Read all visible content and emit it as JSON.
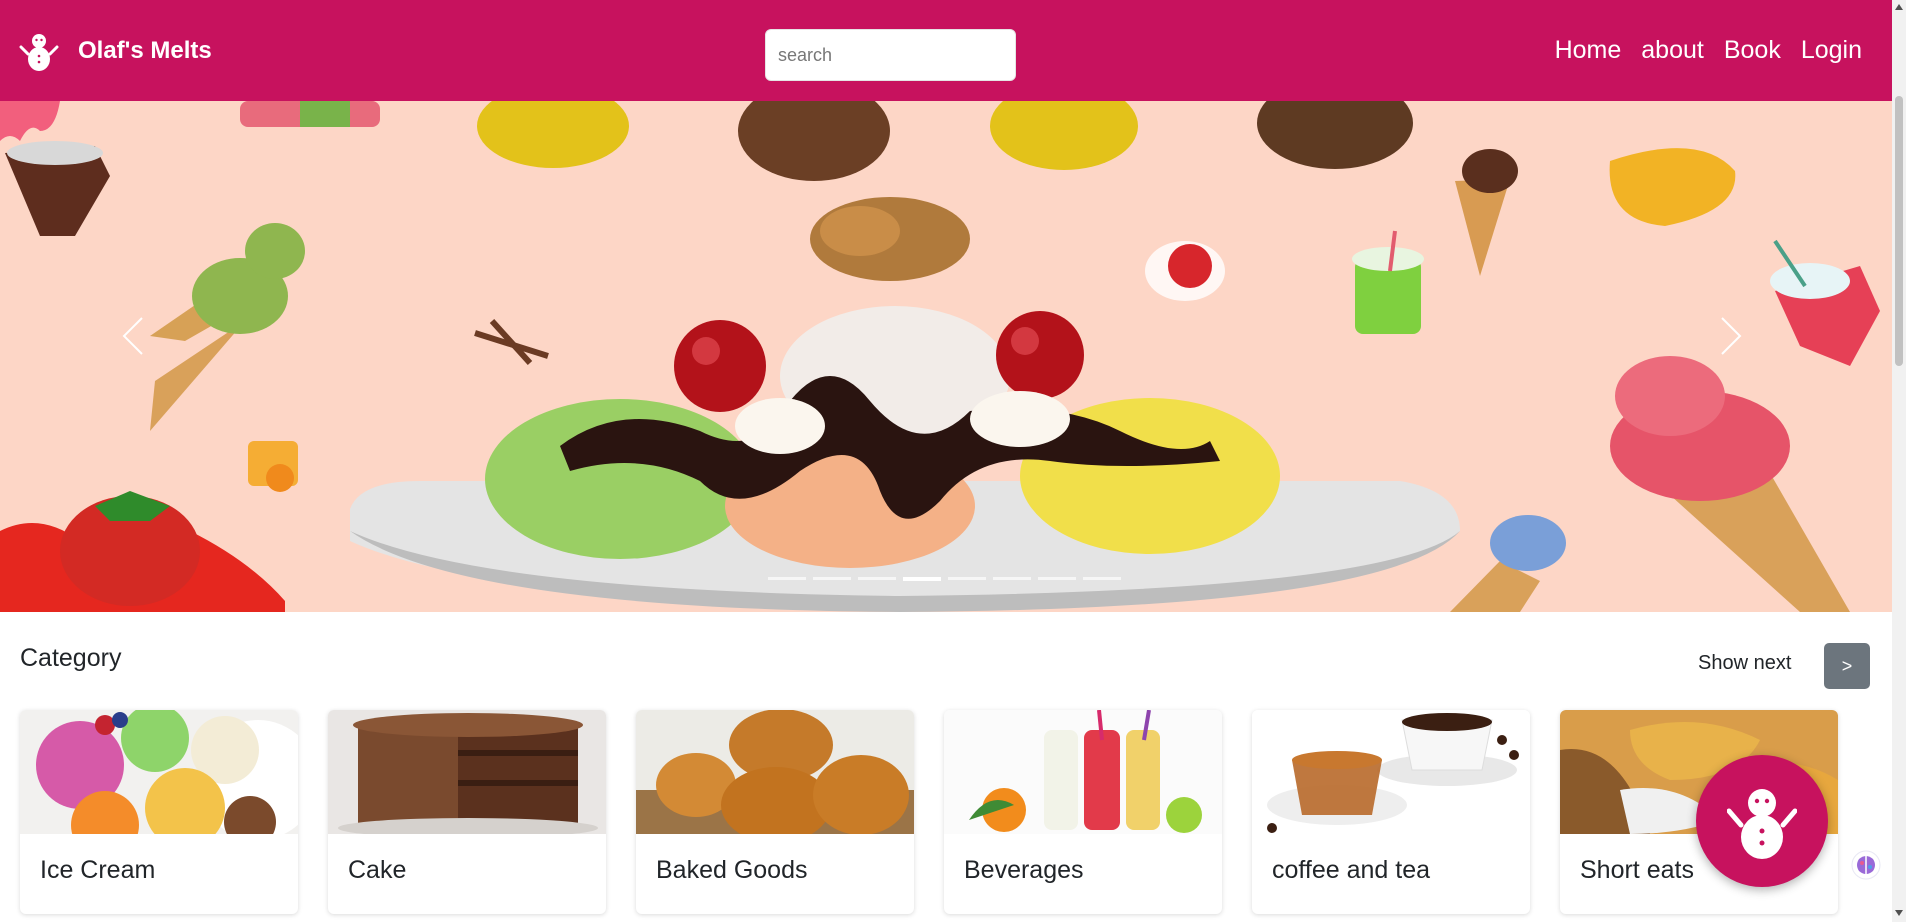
{
  "navbar": {
    "brand_name": "Olaf's Melts",
    "brand_icon": "snowman-icon",
    "search_placeholder": "search",
    "links": [
      "Home",
      "about",
      "Book",
      "Login"
    ],
    "background_color": "#c7125e"
  },
  "hero": {
    "background_color": "#fdd6c6",
    "slide_count": 8,
    "active_slide": 4,
    "prev_icon": "chevron-left-icon",
    "next_icon": "chevron-right-icon"
  },
  "category": {
    "title": "Category",
    "show_next_label": "Show next",
    "next_button_label": ">",
    "items": [
      "Ice Cream",
      "Cake",
      "Baked Goods",
      "Beverages",
      "coffee and tea",
      "Short eats"
    ]
  },
  "floating_button": {
    "icon": "snowman-icon",
    "color": "#c7125e"
  },
  "extension_icon": "brain-icon"
}
